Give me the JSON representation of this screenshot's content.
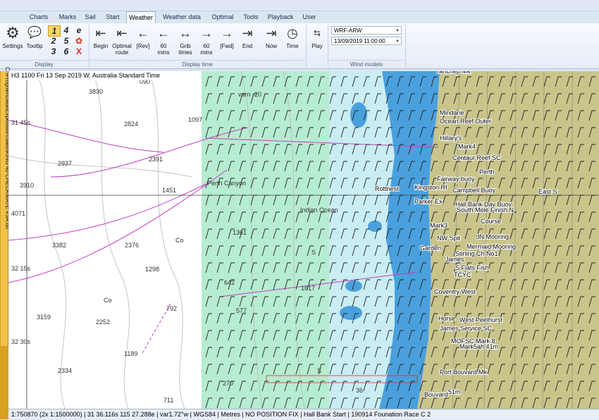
{
  "menu": [
    "Charts",
    "Marks",
    "Sail",
    "Start",
    "Weather",
    "Weather data",
    "Optimal",
    "Tools",
    "Playback",
    "User"
  ],
  "active_menu": "Weather",
  "ribbon": {
    "display": {
      "settings": "Settings",
      "tooltip": "Tooltip",
      "numbers": [
        "1",
        "4",
        "e",
        "2",
        "5",
        "3",
        "6",
        "X"
      ],
      "group": "Display"
    },
    "time": {
      "buttons": [
        {
          "label": "Begin",
          "glyph": "⇤"
        },
        {
          "label": "Optimal\nroute",
          "glyph": "⇤"
        },
        {
          "label": "[Rev]",
          "glyph": "←"
        },
        {
          "label": "60\nmins",
          "glyph": "←"
        },
        {
          "label": "Grib\ntimes",
          "glyph": "↔"
        },
        {
          "label": "60\nmins",
          "glyph": "→"
        },
        {
          "label": "[Fwd]",
          "glyph": "→"
        },
        {
          "label": "End",
          "glyph": "⇥"
        },
        {
          "label": "Now",
          "glyph": "⇥"
        },
        {
          "label": "Time",
          "glyph": "◷"
        },
        {
          "label": "Play",
          "glyph": "⇆"
        }
      ],
      "group": "Display time"
    },
    "wind": {
      "model": "WRF-ARW",
      "datetime": "13/09/2019 11:00:00",
      "group": "Wind models"
    }
  },
  "sidebar_text": "C:\\ProgramData\\Expedition\\Sails\\KING 40 CHECKMATE V3A.txt",
  "sidebar_tab": "Wind",
  "map": {
    "header": "H3 1100 Fri 13 Sep 2019 W. Australia Standard Time",
    "depths": [
      "3830",
      "090",
      "varn -20",
      "2824",
      "1097",
      "31 45s",
      "2937",
      "2391",
      "3910",
      "1451",
      "Perth Canyon",
      "4071",
      "Indian Ocean",
      "3382",
      "2376",
      "1361",
      "Co",
      "32 15s",
      "1298",
      "642",
      "1617",
      "Co",
      "792",
      "3159",
      "2252",
      "577",
      "32 30s",
      "1189",
      "2334",
      "S",
      "711",
      "36",
      "S",
      "270"
    ],
    "places": [
      "Yanchep Mk",
      "Mindarie",
      "Ocean Reef Outer",
      "Hillary's",
      "Mark4",
      "Centaur Reef SC",
      "Perth",
      "Fairway buoy",
      "Rottnest",
      "Kingston Rf",
      "Campbell Buoy",
      "East S",
      "Parker Ex",
      "Hall Bank Day Buoy",
      "South Mole Finish N",
      "Mark3",
      "Course",
      "NW Spit",
      "JN Mooring",
      "Garden",
      "Mermaid Mooring",
      "Stirling Ch No1",
      "James",
      "S Flats Fish",
      "TCYC",
      "Coventry West",
      "Horse",
      "West Peelhurst",
      "James Service SC",
      "MOFSC Mark 8",
      "Mark5ah 41m",
      "Port Bouvard Mk",
      "Bouvard",
      "51m"
    ]
  },
  "status": "1:750870 (2x 1:1500000) | 31 36.116s 115 27.288e | var1.72°w | WGS84 | Metres | NO POSITION FIX | Hall Bank Start | 190914 Founation Race C 2",
  "colors": {
    "deep": "#ffffff",
    "shelf": "#cfeeff",
    "shallow": "#4aa0dd",
    "land": "#c9c48a",
    "wind_area": "#b6ecd0",
    "magenta": "#c040c0"
  }
}
